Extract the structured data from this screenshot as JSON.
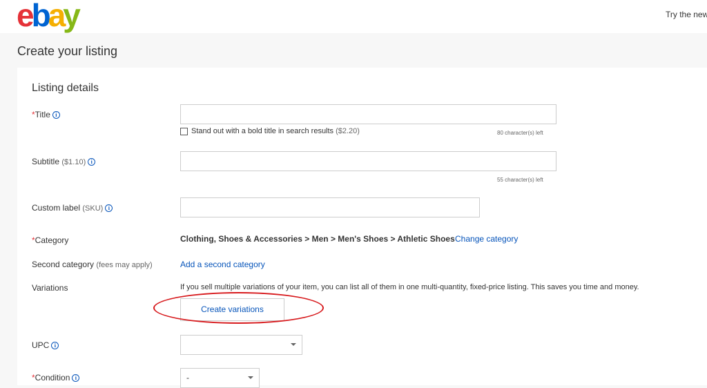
{
  "header": {
    "logo_text": "ebay",
    "try_new": "Try the new"
  },
  "page": {
    "title": "Create your listing"
  },
  "listing_details": {
    "section_title": "Listing details",
    "title_field": {
      "label": "Title",
      "value": "",
      "bold_option_label": "Stand out with a bold title in search results",
      "bold_option_fee": "($2.20)",
      "chars_left": "80 character(s) left"
    },
    "subtitle_field": {
      "label": "Subtitle",
      "fee": "($1.10)",
      "value": "",
      "chars_left": "55 character(s) left"
    },
    "custom_label_field": {
      "label": "Custom label",
      "hint": "(SKU)",
      "value": ""
    },
    "category": {
      "label": "Category",
      "path": "Clothing, Shoes & Accessories > Men > Men's Shoes > Athletic Shoes",
      "change_link": "Change category"
    },
    "second_category": {
      "label": "Second category",
      "hint": "(fees may apply)",
      "add_link": "Add a second category"
    },
    "variations": {
      "label": "Variations",
      "description": "If you sell multiple variations of your item, you can list all of them in one multi-quantity, fixed-price listing. This saves you time and money.",
      "button_label": "Create variations"
    },
    "upc": {
      "label": "UPC",
      "selected": ""
    },
    "condition": {
      "label": "Condition",
      "selected": "-"
    }
  },
  "colors": {
    "required_marker": "#e53238",
    "link": "#0654ba",
    "annotation_ellipse": "#d7191c"
  }
}
